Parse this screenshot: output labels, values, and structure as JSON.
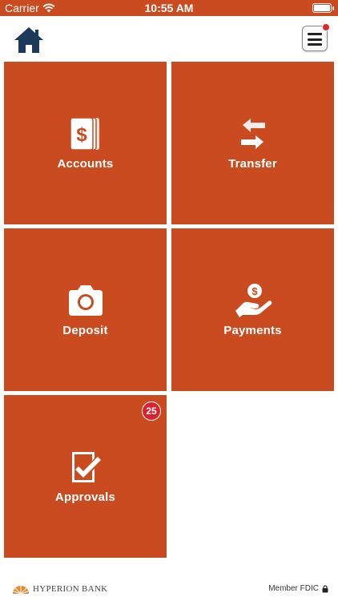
{
  "status_bar": {
    "carrier": "Carrier",
    "time": "10:55 AM"
  },
  "header": {
    "home_icon": "home-icon",
    "menu_icon": "hamburger-menu-icon",
    "menu_has_notification": true
  },
  "tiles": [
    {
      "label": "Accounts",
      "icon": "dollar-cards-icon"
    },
    {
      "label": "Transfer",
      "icon": "transfer-arrows-icon"
    },
    {
      "label": "Deposit",
      "icon": "camera-icon"
    },
    {
      "label": "Payments",
      "icon": "hand-coin-icon"
    },
    {
      "label": "Approvals",
      "icon": "checkbox-check-icon",
      "badge": "25"
    }
  ],
  "footer": {
    "bank_name": "HYPERION BANK",
    "member_text": "Member FDIC"
  },
  "colors": {
    "tile": "#c94b1f",
    "badge": "#d7232f",
    "home_icon": "#1d3a5c"
  }
}
